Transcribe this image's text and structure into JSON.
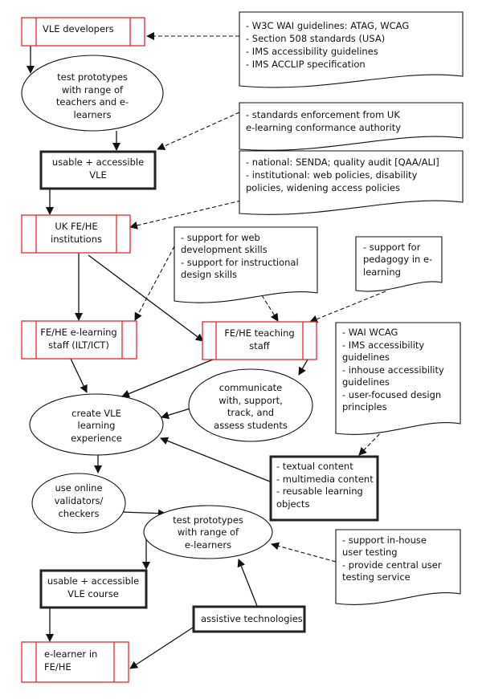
{
  "nodes": {
    "vle_developers": {
      "lines": [
        "VLE developers"
      ]
    },
    "test_prototypes_1": {
      "lines": [
        "test prototypes",
        "with range of",
        "teachers and e-",
        "learners"
      ]
    },
    "usable_vle": {
      "lines": [
        "usable + accessible",
        "VLE"
      ]
    },
    "uk_institutions": {
      "lines": [
        "UK FE/HE",
        "institutions"
      ]
    },
    "elearning_staff": {
      "lines": [
        "FE/HE e-learning",
        "staff (ILT/ICT)"
      ]
    },
    "teaching_staff": {
      "lines": [
        "FE/HE teaching",
        "staff"
      ]
    },
    "communicate": {
      "lines": [
        "communicate",
        "with, support,",
        "track, and",
        "assess students"
      ]
    },
    "create_experience": {
      "lines": [
        "create VLE",
        "learning",
        "experience"
      ]
    },
    "content": {
      "lines": [
        "- textual content",
        "- multimedia content",
        "- reusable learning",
        "objects"
      ]
    },
    "validators": {
      "lines": [
        "use online",
        "validators/",
        "checkers"
      ]
    },
    "test_prototypes_2": {
      "lines": [
        "test prototypes",
        "with range of",
        "e-learners"
      ]
    },
    "usable_course": {
      "lines": [
        "usable + accessible",
        "VLE course"
      ]
    },
    "assistive": {
      "lines": [
        "assistive technologies"
      ]
    },
    "elearner": {
      "lines": [
        "e-learner in",
        "FE/HE"
      ]
    }
  },
  "documents": {
    "guidelines": {
      "lines": [
        "- W3C WAI guidelines: ATAG, WCAG",
        "- Section 508 standards (USA)",
        "- IMS accessibility guidelines",
        "- IMS ACCLIP specification"
      ]
    },
    "enforcement": {
      "lines": [
        "- standards enforcement from UK",
        "e-learning conformance authority"
      ]
    },
    "policies": {
      "lines": [
        "- national: SENDA; quality audit [QAA/ALI]",
        "- institutional: web policies, disability",
        "policies, widening access policies"
      ]
    },
    "skills": {
      "lines": [
        "- support for web",
        "development skills",
        "- support for instructional",
        "design skills"
      ]
    },
    "pedagogy": {
      "lines": [
        "- support for",
        "pedagogy in e-",
        "learning"
      ]
    },
    "standards": {
      "lines": [
        "- WAI WCAG",
        "- IMS accessibility",
        "guidelines",
        "- inhouse accessibility",
        "guidelines",
        "- user-focused design",
        "principles"
      ]
    },
    "user_testing": {
      "lines": [
        "- support in-house",
        "user testing",
        "- provide central user",
        "testing service"
      ]
    }
  },
  "colors": {
    "actor_border": "#e8262a",
    "line": "#111111"
  }
}
